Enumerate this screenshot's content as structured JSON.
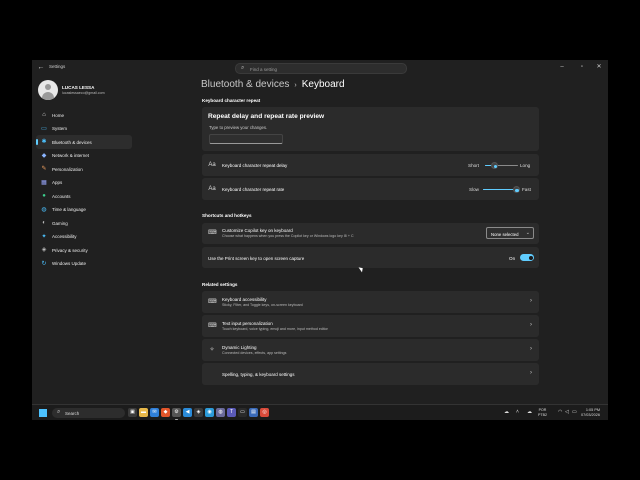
{
  "window": {
    "app_title": "Settings",
    "search_placeholder": "Find a setting",
    "back_icon": "back-arrow-icon",
    "controls": [
      "minimize-icon",
      "maximize-icon",
      "close-icon"
    ]
  },
  "user": {
    "name": "LUCAS LESSA",
    "email": "lucaslessaeco@gmail.com"
  },
  "sidebar": {
    "items": [
      {
        "label": "Home",
        "icon": "home-icon",
        "color": "#d9d9d9",
        "active": false
      },
      {
        "label": "System",
        "icon": "system-icon",
        "color": "#4cc2ff",
        "active": false
      },
      {
        "label": "Bluetooth & devices",
        "icon": "bluetooth-icon",
        "color": "#4cc2ff",
        "active": true
      },
      {
        "label": "Network & internet",
        "icon": "network-icon",
        "color": "#8ab4ff",
        "active": false
      },
      {
        "label": "Personalization",
        "icon": "brush-icon",
        "color": "#f0a060",
        "active": false
      },
      {
        "label": "Apps",
        "icon": "apps-icon",
        "color": "#9aa8ff",
        "active": false
      },
      {
        "label": "Accounts",
        "icon": "accounts-icon",
        "color": "#3ccf8e",
        "active": false
      },
      {
        "label": "Time & language",
        "icon": "globe-clock-icon",
        "color": "#4cc2ff",
        "active": false
      },
      {
        "label": "Gaming",
        "icon": "gaming-icon",
        "color": "#bbbbbb",
        "active": false
      },
      {
        "label": "Accessibility",
        "icon": "accessibility-icon",
        "color": "#4cc2ff",
        "active": false
      },
      {
        "label": "Privacy & security",
        "icon": "shield-icon",
        "color": "#bbbbbb",
        "active": false
      },
      {
        "label": "Windows Update",
        "icon": "update-icon",
        "color": "#4cc2ff",
        "active": false
      }
    ]
  },
  "breadcrumb": {
    "parent": "Bluetooth & devices",
    "separator": "›",
    "current": "Keyboard"
  },
  "sections": {
    "char_repeat": "Keyboard character repeat",
    "shortcuts": "Shortcuts and hotkeys",
    "related": "Related settings"
  },
  "preview": {
    "title": "Repeat delay and repeat rate preview",
    "subtitle": "Type to preview your changes."
  },
  "repeat_delay": {
    "label": "Keyboard character repeat delay",
    "min_label": "Short",
    "max_label": "Long",
    "value": 0.3,
    "icon": "keyboard-delay-icon"
  },
  "repeat_rate": {
    "label": "Keyboard character repeat rate",
    "min_label": "Slow",
    "max_label": "Fast",
    "value": 1.0,
    "icon": "keyboard-rate-icon"
  },
  "copilot_key": {
    "label": "Customize Copilot key on keyboard",
    "desc": "Choose what happens when you press the Copilot key or Windows logo key ⊞ + C",
    "dropdown_value": "None selected",
    "icon": "keyboard-icon"
  },
  "print_screen": {
    "label": "Use the Print screen key to open screen capture",
    "state_label": "On",
    "on": true
  },
  "related": [
    {
      "title": "Keyboard accessibility",
      "desc": "Sticky, Filter, and Toggle keys, on-screen keyboard",
      "icon": "keyboard-access-icon"
    },
    {
      "title": "Text input personalization",
      "desc": "Touch keyboard, voice typing, emoji and more, input method editor",
      "icon": "text-input-icon"
    },
    {
      "title": "Dynamic Lighting",
      "desc": "Connected devices, effects, app settings",
      "icon": "lighting-icon"
    },
    {
      "title": "Spelling, typing, & keyboard settings",
      "desc": "",
      "icon": "spelling-icon"
    }
  ],
  "taskbar": {
    "search_label": "Search",
    "apps": [
      {
        "icon": "task-view-icon",
        "color": "#3a3a3a",
        "glyph": "▣",
        "running": false
      },
      {
        "icon": "file-explorer-icon",
        "color": "#e8b84a",
        "glyph": "▬",
        "running": false
      },
      {
        "icon": "mail-icon",
        "color": "#2f7fd8",
        "glyph": "✉",
        "running": false
      },
      {
        "icon": "brave-browser-icon",
        "color": "#e2552a",
        "glyph": "◆",
        "running": false
      },
      {
        "icon": "settings-icon",
        "color": "#555555",
        "glyph": "⚙",
        "running": true
      },
      {
        "icon": "vscode-icon",
        "color": "#2a8ad8",
        "glyph": "◀",
        "running": false
      },
      {
        "icon": "git-icon",
        "color": "#3a3a3a",
        "glyph": "◈",
        "running": false
      },
      {
        "icon": "edge-icon",
        "color": "#2b9ad8",
        "glyph": "◉",
        "running": false
      },
      {
        "icon": "globe-app-icon",
        "color": "#6a6a9a",
        "glyph": "◍",
        "running": false
      },
      {
        "icon": "teams-icon",
        "color": "#5a5ab8",
        "glyph": "T",
        "running": false
      },
      {
        "icon": "terminal-icon",
        "color": "#2a2a2a",
        "glyph": "▭",
        "running": false
      },
      {
        "icon": "notepad-icon",
        "color": "#3a6ab8",
        "glyph": "▤",
        "running": false
      },
      {
        "icon": "chrome-icon",
        "color": "#d84a3a",
        "glyph": "◎",
        "running": false
      }
    ],
    "tray_icons": [
      "cloud-icon",
      "chevron-up-icon",
      "wifi-icon",
      "volume-icon",
      "battery-icon"
    ],
    "lang_top": "POR",
    "lang_bottom": "PTB2",
    "time": "1:05 PM",
    "date": "07/03/2026"
  }
}
